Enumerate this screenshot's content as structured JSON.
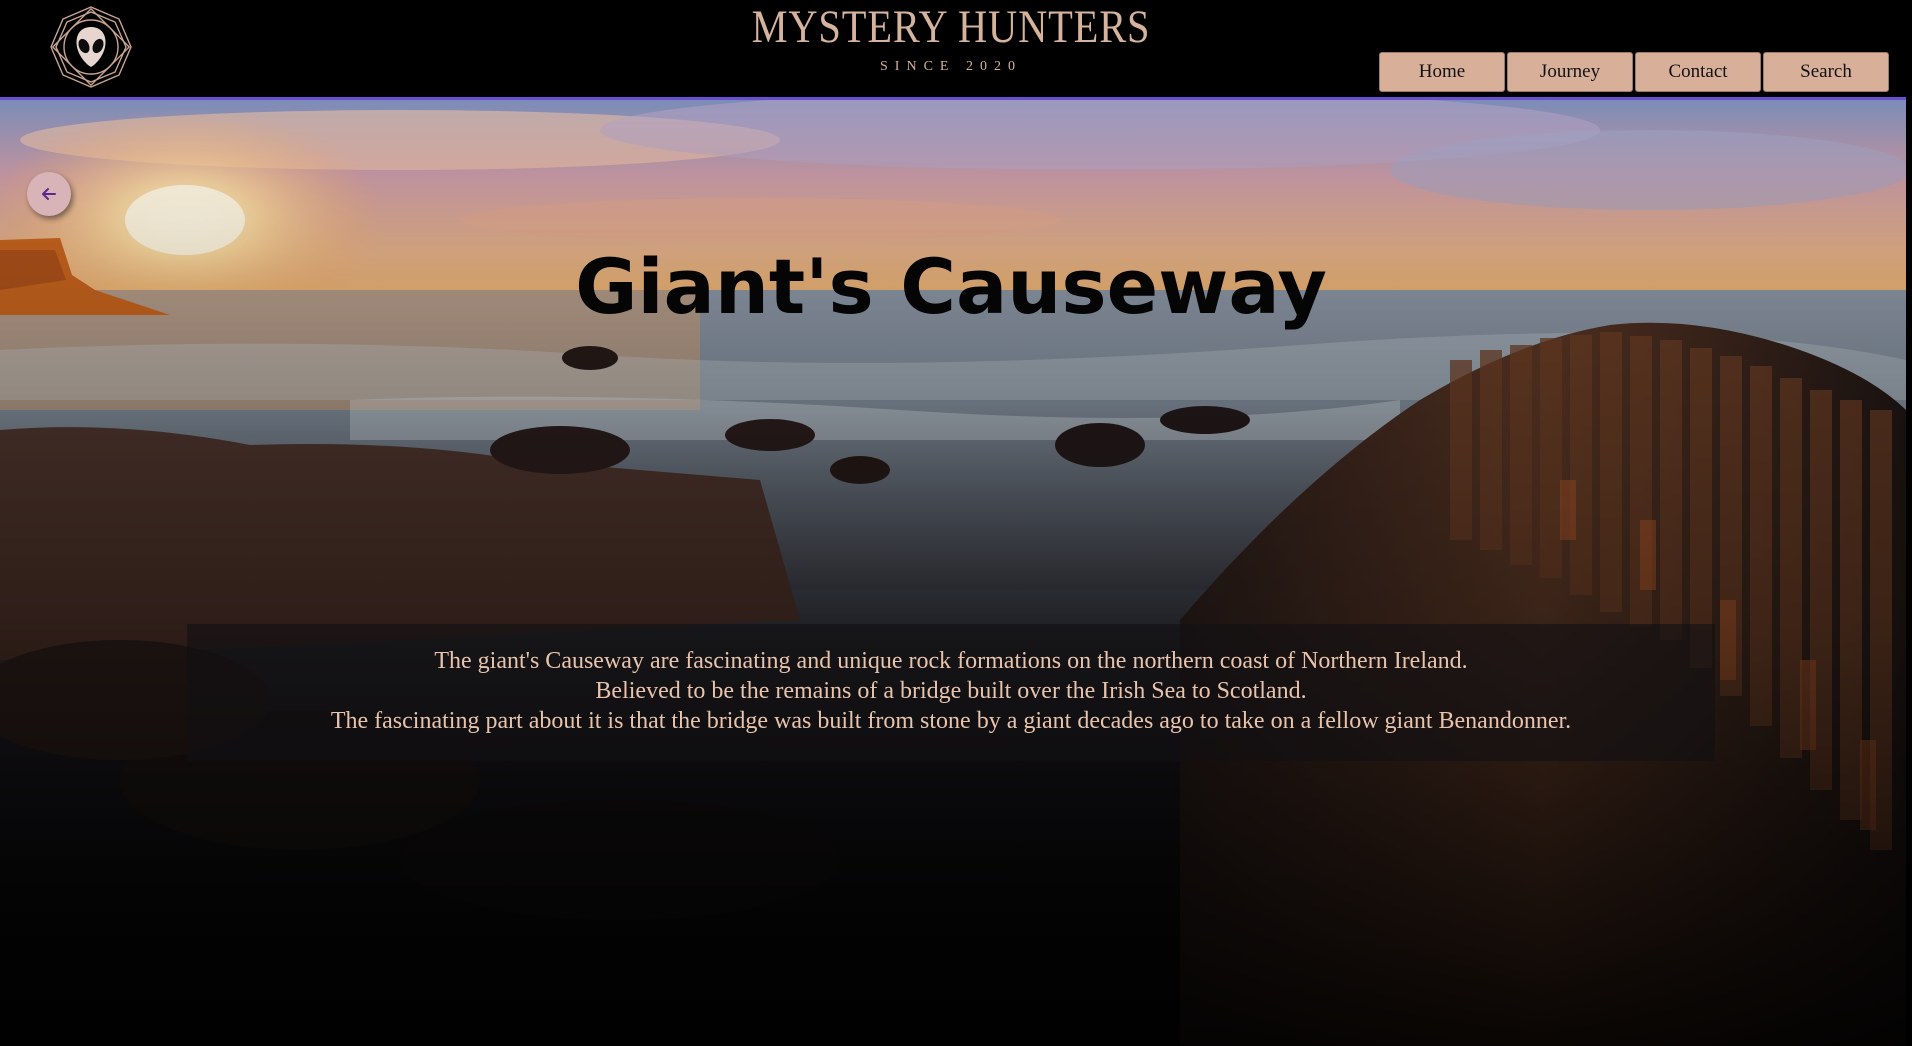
{
  "header": {
    "brand_title": "MYSTERY HUNTERS",
    "brand_subtitle": "SINCE 2020",
    "logo_icon": "alien-head-icon",
    "nav": [
      {
        "label": "Home"
      },
      {
        "label": "Journey"
      },
      {
        "label": "Contact"
      },
      {
        "label": "Search"
      }
    ]
  },
  "hero": {
    "back_icon": "arrow-left-icon",
    "title": "Giant's Causeway",
    "description": [
      "The giant's Causeway are fascinating and unique rock formations on the northern coast of Northern Ireland.",
      "Believed to be the remains of a bridge built over the Irish Sea to Scotland.",
      "The fascinating part about it is that the bridge was built from stone by a giant decades ago to take on a fellow giant Benandonner."
    ]
  },
  "colors": {
    "accent": "#d8b09a",
    "text_light": "#e8c4ad",
    "back_button": "#d8b3b8",
    "back_arrow": "#5a2a8a",
    "hero_border": "#6a4fd0"
  }
}
